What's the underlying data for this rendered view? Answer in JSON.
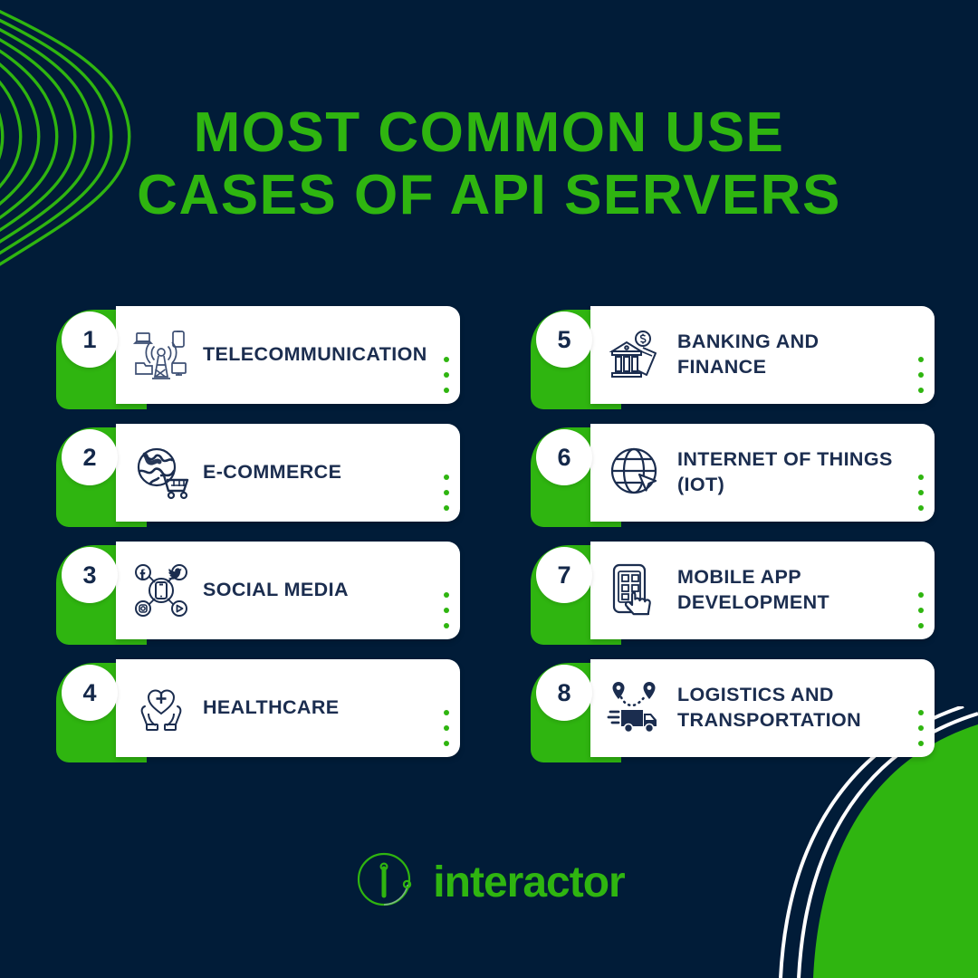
{
  "theme": {
    "background": "#011c38",
    "accent_green": "#2fb510",
    "card_bg": "#ffffff",
    "text_navy": "#1b2d4f"
  },
  "header": {
    "title_line1": "MOST COMMON USE",
    "title_line2": "CASES OF API SERVERS"
  },
  "cards": [
    {
      "number": "1",
      "label": "TELECOMMUNICATION",
      "icon": "broadcast-tower-icon"
    },
    {
      "number": "2",
      "label": "E-COMMERCE",
      "icon": "globe-shopping-cart-icon"
    },
    {
      "number": "3",
      "label": "SOCIAL MEDIA",
      "icon": "social-network-phone-icon"
    },
    {
      "number": "4",
      "label": "HEALTHCARE",
      "icon": "hands-heart-cross-icon"
    },
    {
      "number": "5",
      "label": "BANKING AND FINANCE",
      "icon": "bank-money-icon"
    },
    {
      "number": "6",
      "label": "INTERNET OF THINGS (IOT)",
      "icon": "globe-cursor-icon"
    },
    {
      "number": "7",
      "label": "MOBILE APP DEVELOPMENT",
      "icon": "phone-hand-tap-icon"
    },
    {
      "number": "8",
      "label": "LOGISTICS AND TRANSPORTATION",
      "icon": "truck-route-pins-icon"
    }
  ],
  "footer": {
    "brand": "interactor",
    "logo_icon": "interactor-circle-i-icon"
  }
}
